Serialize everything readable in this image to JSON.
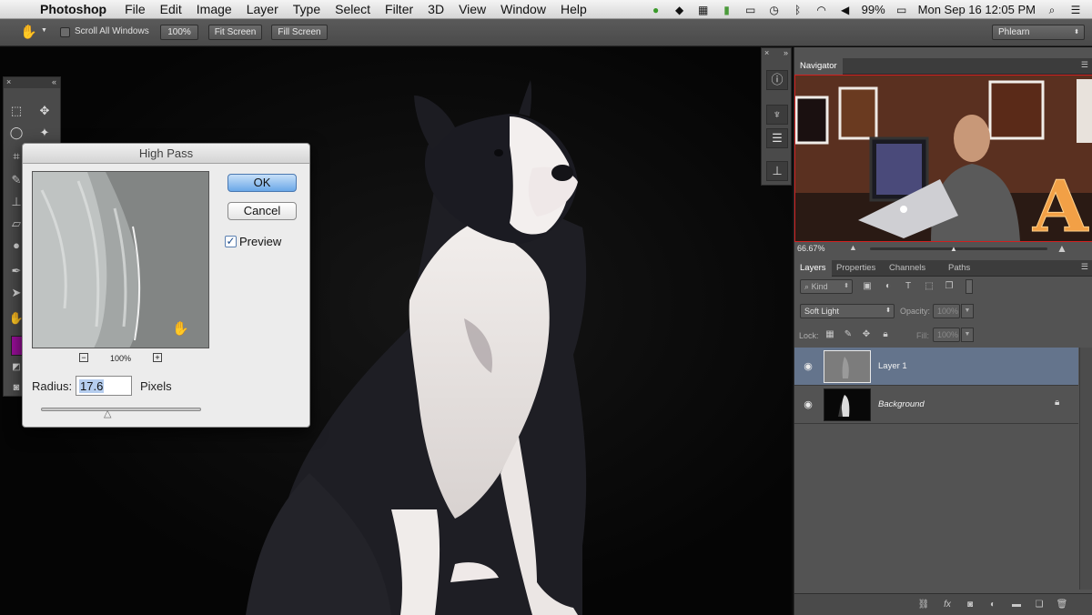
{
  "menubar": {
    "app": "Photoshop",
    "menus": [
      "File",
      "Edit",
      "Image",
      "Layer",
      "Type",
      "Select",
      "Filter",
      "3D",
      "View",
      "Window",
      "Help"
    ],
    "battery": "99%",
    "datetime": "Mon Sep 16  12:05 PM"
  },
  "options": {
    "scroll_all": "Scroll All Windows",
    "btn_100": "100%",
    "btn_fit": "Fit Screen",
    "btn_fill": "Fill Screen",
    "workspace": "Phlearn"
  },
  "dialog": {
    "title": "High Pass",
    "ok": "OK",
    "cancel": "Cancel",
    "preview": "Preview",
    "preview_checked": true,
    "zoom": "100%",
    "radius_label": "Radius:",
    "radius_value": "17.6",
    "unit": "Pixels"
  },
  "navigator": {
    "tab": "Navigator",
    "zoom": "66.67%",
    "sign_letter": "A"
  },
  "layers_panel": {
    "tabs": [
      "Layers",
      "Properties",
      "Channels",
      "Paths"
    ],
    "filter_kind": "Kind",
    "blend_mode": "Soft Light",
    "opacity_label": "Opacity:",
    "opacity_value": "100%",
    "lock_label": "Lock:",
    "fill_label": "Fill:",
    "fill_value": "100%",
    "layers": [
      {
        "name": "Layer 1",
        "selected": true
      },
      {
        "name": "Background",
        "selected": false,
        "locked": true
      }
    ]
  },
  "colors": {
    "foreground": "#9a0e9a",
    "selected_layer": "#64748c"
  }
}
